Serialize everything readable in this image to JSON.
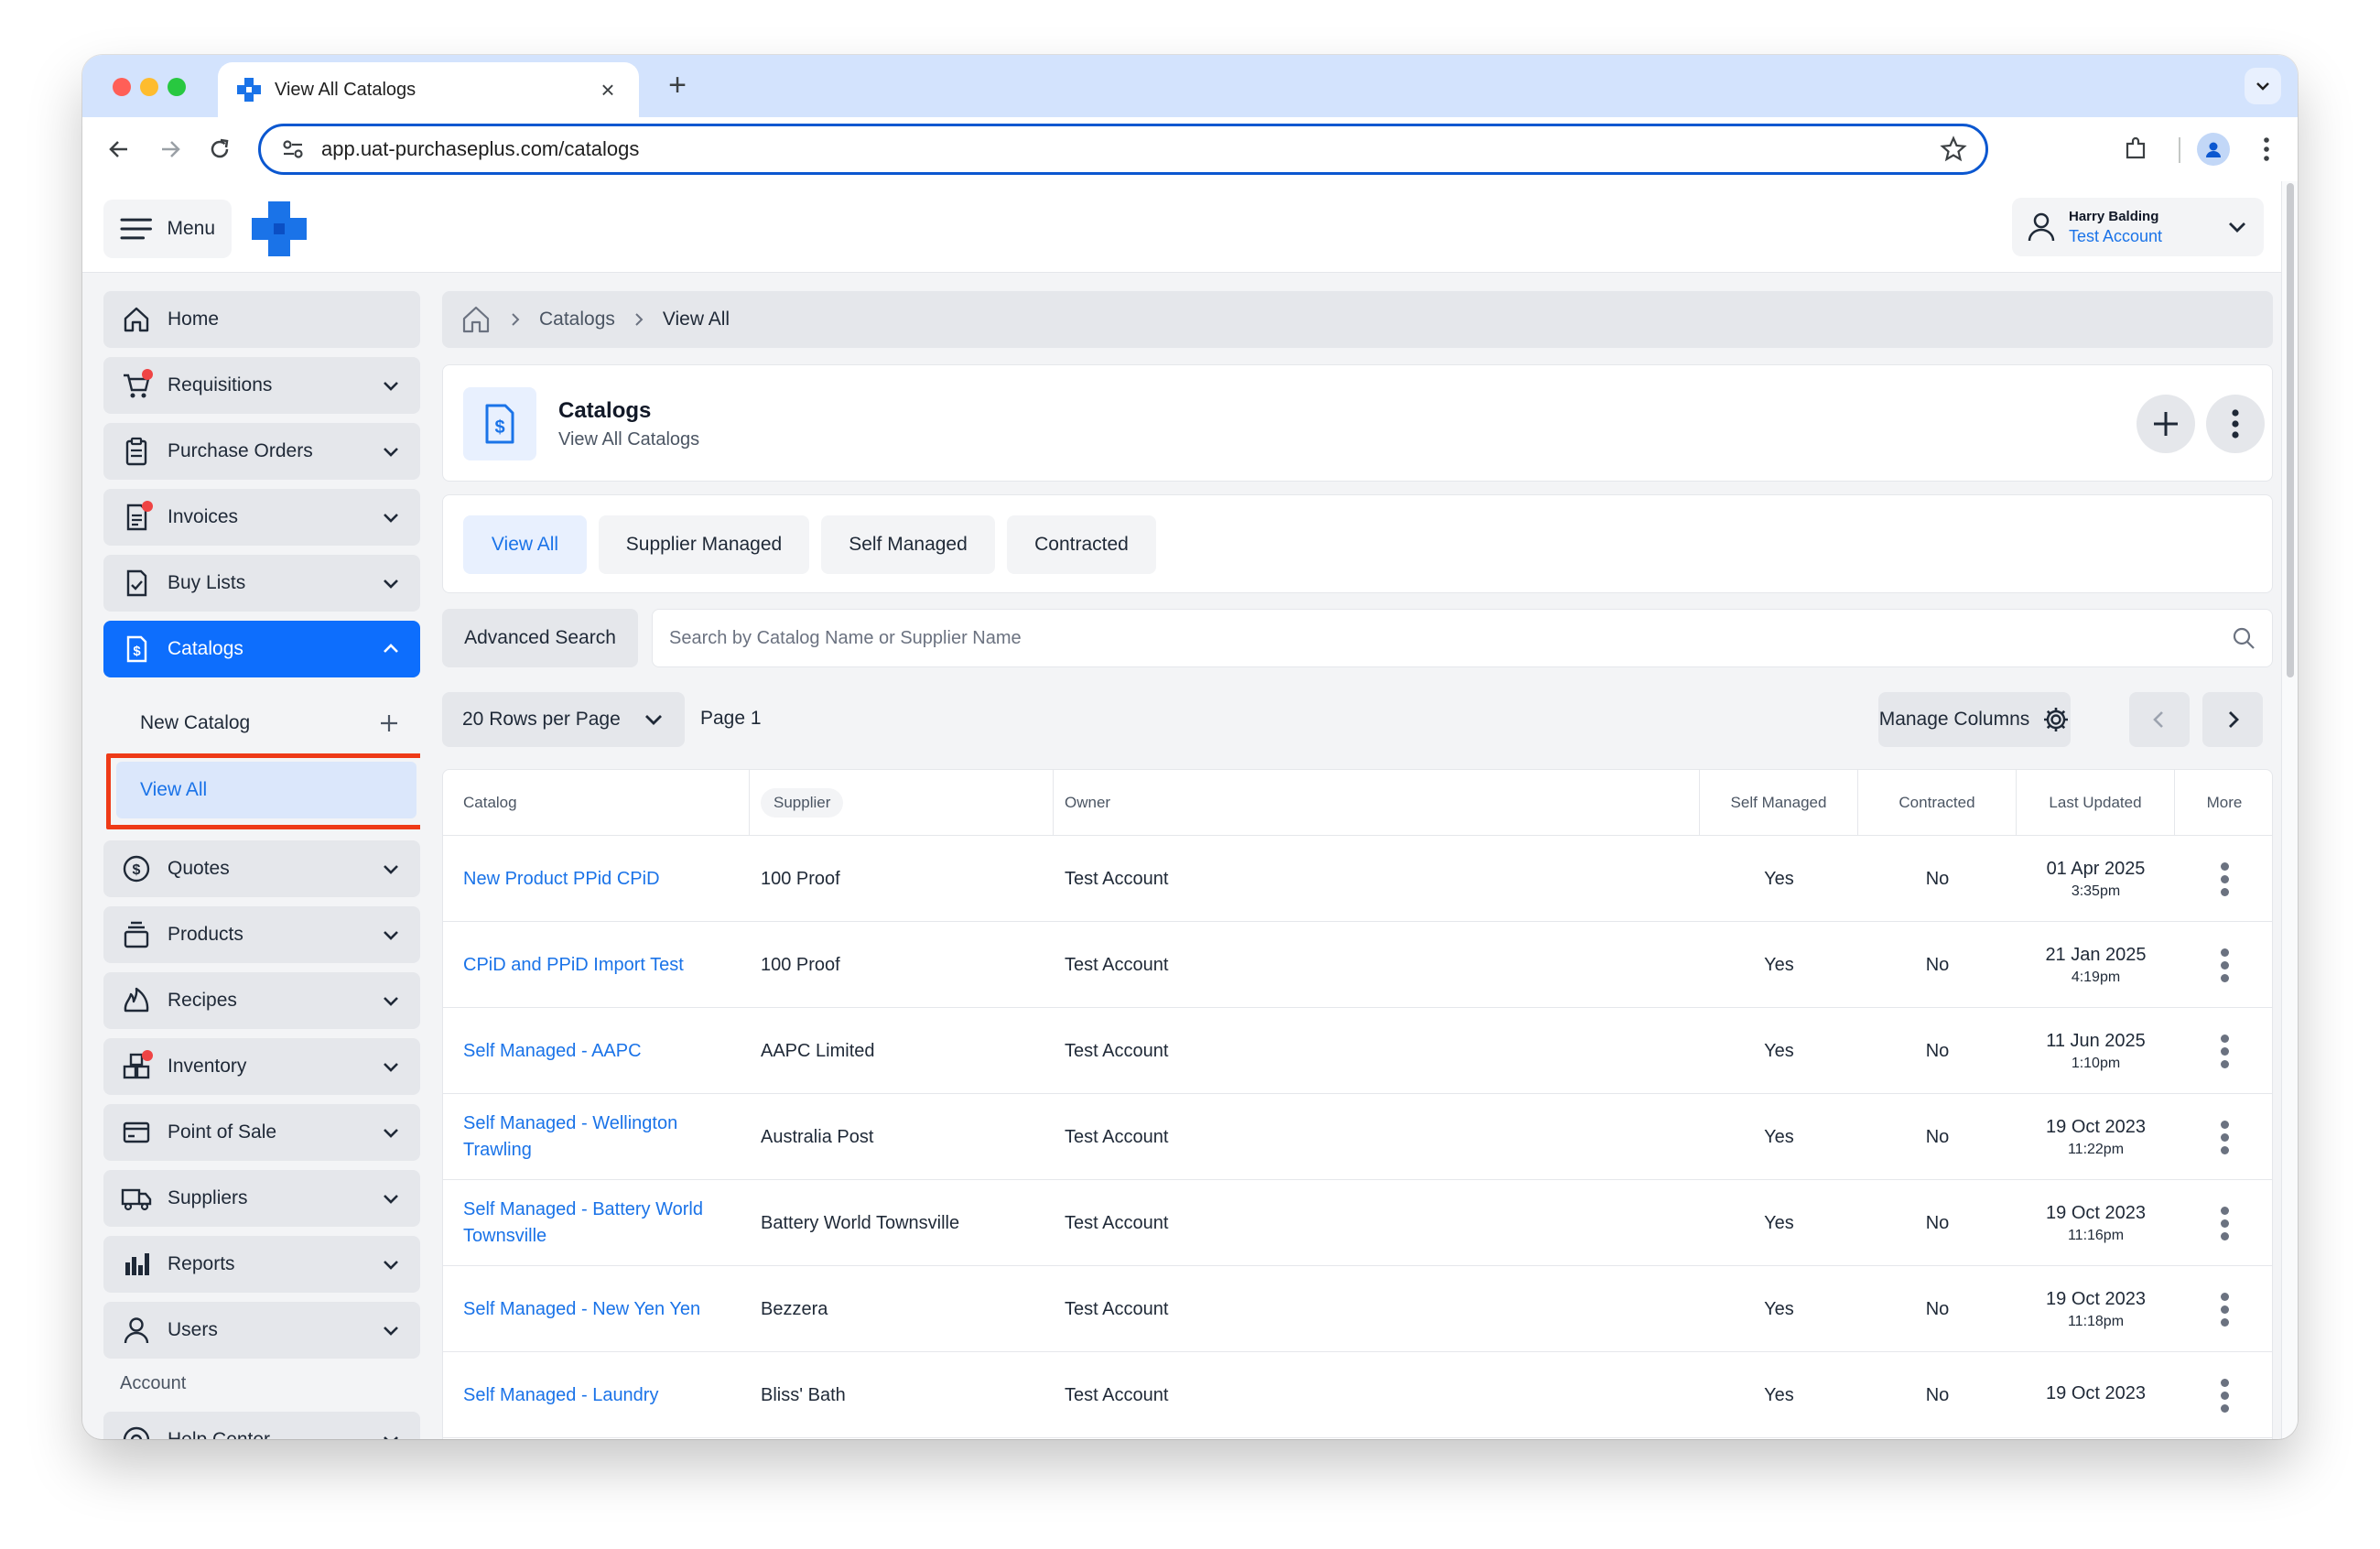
{
  "browser": {
    "tab_title": "View All Catalogs",
    "url": "app.uat-purchaseplus.com/catalogs"
  },
  "header": {
    "menu_label": "Menu",
    "user_name": "Harry Balding",
    "user_account": "Test Account"
  },
  "sidebar": {
    "items": [
      {
        "label": "Home",
        "icon": "home-icon"
      },
      {
        "label": "Requisitions",
        "icon": "cart-icon"
      },
      {
        "label": "Purchase Orders",
        "icon": "clipboard-icon"
      },
      {
        "label": "Invoices",
        "icon": "invoice-icon"
      },
      {
        "label": "Buy Lists",
        "icon": "checklist-icon"
      },
      {
        "label": "Catalogs",
        "icon": "catalog-dollar-icon"
      },
      {
        "label": "Quotes",
        "icon": "dollar-circle-icon"
      },
      {
        "label": "Products",
        "icon": "stack-icon"
      },
      {
        "label": "Recipes",
        "icon": "flame-icon"
      },
      {
        "label": "Inventory",
        "icon": "boxes-icon"
      },
      {
        "label": "Point of Sale",
        "icon": "card-icon"
      },
      {
        "label": "Suppliers",
        "icon": "truck-icon"
      },
      {
        "label": "Reports",
        "icon": "bar-chart-icon"
      },
      {
        "label": "Users",
        "icon": "user-icon"
      },
      {
        "label": "Help Center",
        "icon": "lifebuoy-icon"
      }
    ],
    "sub_new": "New Catalog",
    "sub_view_all": "View All",
    "section_account": "Account"
  },
  "breadcrumb": {
    "items": [
      "Catalogs",
      "View All"
    ]
  },
  "page": {
    "title": "Catalogs",
    "subtitle": "View All Catalogs"
  },
  "filters": {
    "tabs": [
      "View All",
      "Supplier Managed",
      "Self Managed",
      "Contracted"
    ],
    "active": "View All"
  },
  "search": {
    "advanced_label": "Advanced Search",
    "placeholder": "Search by Catalog Name or Supplier Name"
  },
  "pagination": {
    "rows_per_page": "20 Rows per Page",
    "page_label": "Page 1",
    "manage_columns": "Manage Columns"
  },
  "table": {
    "headers": [
      "Catalog",
      "Supplier",
      "Owner",
      "Self Managed",
      "Contracted",
      "Last Updated",
      "More"
    ],
    "rows": [
      {
        "catalog": "New Product PPid CPiD",
        "supplier": "100 Proof",
        "owner": "Test Account",
        "self_managed": "Yes",
        "contracted": "No",
        "date": "01 Apr 2025",
        "time": "3:35pm"
      },
      {
        "catalog": "CPiD and PPiD Import Test",
        "supplier": "100 Proof",
        "owner": "Test Account",
        "self_managed": "Yes",
        "contracted": "No",
        "date": "21 Jan 2025",
        "time": "4:19pm"
      },
      {
        "catalog": "Self Managed - AAPC",
        "supplier": "AAPC Limited",
        "owner": "Test Account",
        "self_managed": "Yes",
        "contracted": "No",
        "date": "11 Jun 2025",
        "time": "1:10pm"
      },
      {
        "catalog": "Self Managed - Wellington Trawling",
        "supplier": "Australia Post",
        "owner": "Test Account",
        "self_managed": "Yes",
        "contracted": "No",
        "date": "19 Oct 2023",
        "time": "11:22pm"
      },
      {
        "catalog": "Self Managed - Battery World Townsville",
        "supplier": "Battery World Townsville",
        "owner": "Test Account",
        "self_managed": "Yes",
        "contracted": "No",
        "date": "19 Oct 2023",
        "time": "11:16pm"
      },
      {
        "catalog": "Self Managed - New Yen Yen",
        "supplier": "Bezzera",
        "owner": "Test Account",
        "self_managed": "Yes",
        "contracted": "No",
        "date": "19 Oct 2023",
        "time": "11:18pm"
      },
      {
        "catalog": "Self Managed - Laundry",
        "supplier": "Bliss' Bath",
        "owner": "Test Account",
        "self_managed": "Yes",
        "contracted": "No",
        "date": "19 Oct 2023",
        "time": ""
      }
    ]
  },
  "colors": {
    "accent": "#0d6efd",
    "link": "#1a73e8",
    "highlight": "#ee3a17",
    "notification": "#ef4444"
  }
}
